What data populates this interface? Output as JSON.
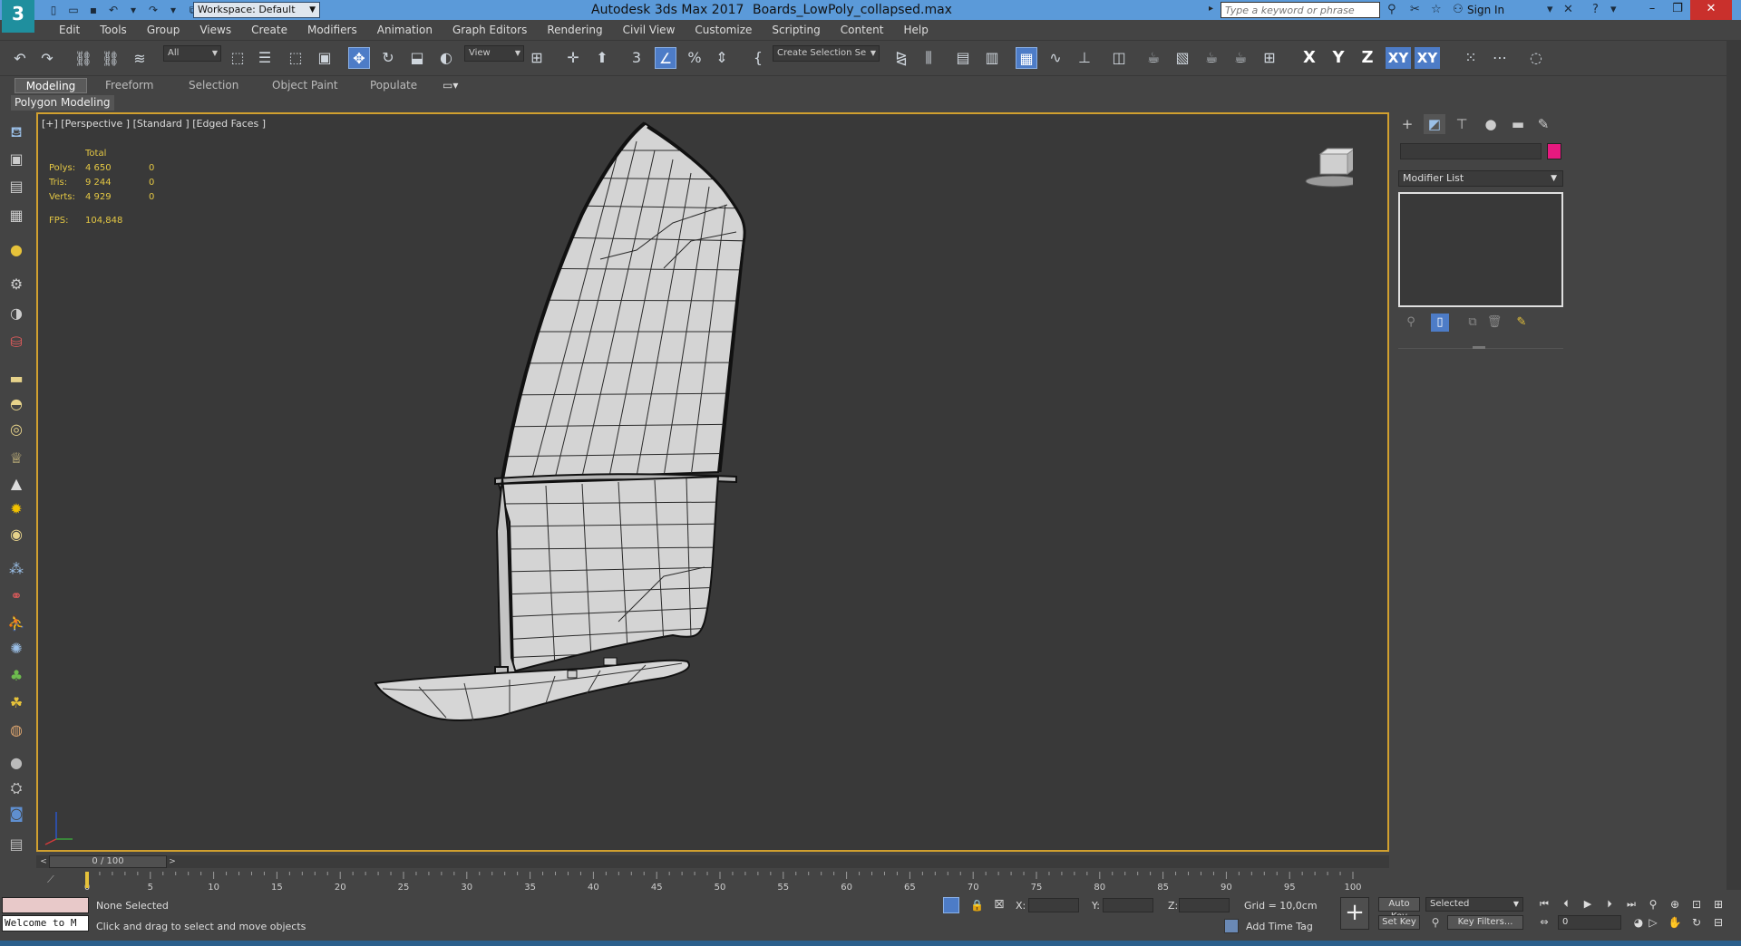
{
  "titlebar": {
    "app_logo": "3",
    "workspace": "Workspace: Default",
    "app_title": "Autodesk 3ds Max 2017",
    "file_name": "Boards_LowPoly_collapsed.max",
    "search_placeholder": "Type a keyword or phrase",
    "sign_in": "Sign In",
    "brand_color": "#5b9ad9"
  },
  "menu": [
    "Edit",
    "Tools",
    "Group",
    "Views",
    "Create",
    "Modifiers",
    "Animation",
    "Graph Editors",
    "Rendering",
    "Civil View",
    "Customize",
    "Scripting",
    "Content",
    "Help"
  ],
  "toolbar": {
    "selection_filter": "All",
    "ref_coord": "View",
    "named_selection": "Create Selection Se",
    "axis_x": "X",
    "axis_y": "Y",
    "axis_z": "Z",
    "axis_xy": "XY",
    "axis_xy2": "XY"
  },
  "ribbon": {
    "tabs": [
      "Modeling",
      "Freeform",
      "Selection",
      "Object Paint",
      "Populate"
    ],
    "active_tab": "Modeling",
    "panel": "Polygon Modeling"
  },
  "viewport": {
    "label": "[+] [Perspective ] [Standard ] [Edged Faces ]",
    "stats_header": "Total",
    "stats": [
      {
        "name": "Polys:",
        "total": "4 650",
        "sel": "0"
      },
      {
        "name": "Tris:",
        "total": "9 244",
        "sel": "0"
      },
      {
        "name": "Verts:",
        "total": "4 929",
        "sel": "0"
      }
    ],
    "fps_label": "FPS:",
    "fps_value": "104,848",
    "border_color": "#d1a02f"
  },
  "command_panel": {
    "modifier_list": "Modifier List",
    "object_color": "#e6197f"
  },
  "time_slider": {
    "position": "0 / 100",
    "ticks": [
      "0",
      "5",
      "10",
      "15",
      "20",
      "25",
      "30",
      "35",
      "40",
      "45",
      "50",
      "55",
      "60",
      "65",
      "70",
      "75",
      "80",
      "85",
      "90",
      "95",
      "100"
    ]
  },
  "status": {
    "maxscript": "Welcome to M",
    "selection": "None Selected",
    "prompt": "Click and drag to select and move objects",
    "x_label": "X:",
    "y_label": "Y:",
    "z_label": "Z:",
    "grid": "Grid = 10,0cm",
    "add_time_tag": "Add Time Tag",
    "auto_key": "Auto Key",
    "set_key": "Set Key",
    "key_mode": "Selected",
    "key_filters": "Key Filters...",
    "current_frame": "0"
  }
}
